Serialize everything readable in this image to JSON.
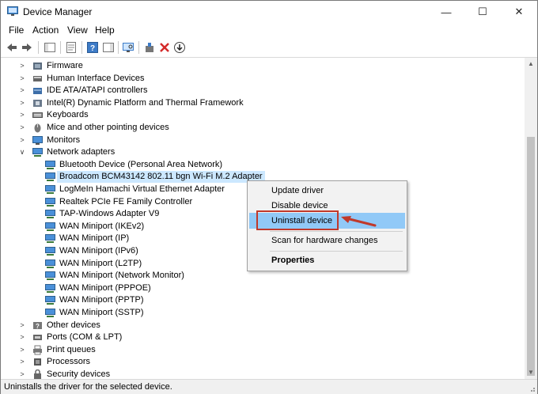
{
  "window": {
    "title": "Device Manager",
    "controls": [
      "—",
      "☐",
      "✕"
    ]
  },
  "menu": [
    "File",
    "Action",
    "View",
    "Help"
  ],
  "tree": {
    "items": [
      {
        "label": "Firmware",
        "level": 0,
        "expanded": false,
        "icon": "firmware-icon"
      },
      {
        "label": "Human Interface Devices",
        "level": 0,
        "expanded": false,
        "icon": "hid-icon"
      },
      {
        "label": "IDE ATA/ATAPI controllers",
        "level": 0,
        "expanded": false,
        "icon": "ide-icon"
      },
      {
        "label": "Intel(R) Dynamic Platform and Thermal Framework",
        "level": 0,
        "expanded": false,
        "icon": "thermal-icon"
      },
      {
        "label": "Keyboards",
        "level": 0,
        "expanded": false,
        "icon": "keyboard-icon"
      },
      {
        "label": "Mice and other pointing devices",
        "level": 0,
        "expanded": false,
        "icon": "mouse-icon"
      },
      {
        "label": "Monitors",
        "level": 0,
        "expanded": false,
        "icon": "monitor-icon"
      },
      {
        "label": "Network adapters",
        "level": 0,
        "expanded": true,
        "icon": "network-icon"
      },
      {
        "label": "Bluetooth Device (Personal Area Network)",
        "level": 1,
        "icon": "network-adapter-icon"
      },
      {
        "label": "Broadcom BCM43142 802.11 bgn Wi-Fi M.2 Adapter",
        "level": 1,
        "selected": true,
        "icon": "network-adapter-icon"
      },
      {
        "label": "LogMeIn Hamachi Virtual Ethernet Adapter",
        "level": 1,
        "icon": "network-adapter-icon"
      },
      {
        "label": "Realtek PCIe FE Family Controller",
        "level": 1,
        "icon": "network-adapter-icon"
      },
      {
        "label": "TAP-Windows Adapter V9",
        "level": 1,
        "icon": "network-adapter-icon"
      },
      {
        "label": "WAN Miniport (IKEv2)",
        "level": 1,
        "icon": "network-adapter-icon"
      },
      {
        "label": "WAN Miniport (IP)",
        "level": 1,
        "icon": "network-adapter-icon"
      },
      {
        "label": "WAN Miniport (IPv6)",
        "level": 1,
        "icon": "network-adapter-icon"
      },
      {
        "label": "WAN Miniport (L2TP)",
        "level": 1,
        "icon": "network-adapter-icon"
      },
      {
        "label": "WAN Miniport (Network Monitor)",
        "level": 1,
        "icon": "network-adapter-icon"
      },
      {
        "label": "WAN Miniport (PPPOE)",
        "level": 1,
        "icon": "network-adapter-icon"
      },
      {
        "label": "WAN Miniport (PPTP)",
        "level": 1,
        "icon": "network-adapter-icon"
      },
      {
        "label": "WAN Miniport (SSTP)",
        "level": 1,
        "icon": "network-adapter-icon"
      },
      {
        "label": "Other devices",
        "level": 0,
        "expanded": false,
        "icon": "other-devices-icon"
      },
      {
        "label": "Ports (COM & LPT)",
        "level": 0,
        "expanded": false,
        "icon": "ports-icon"
      },
      {
        "label": "Print queues",
        "level": 0,
        "expanded": false,
        "icon": "printer-icon"
      },
      {
        "label": "Processors",
        "level": 0,
        "expanded": false,
        "icon": "processor-icon"
      },
      {
        "label": "Security devices",
        "level": 0,
        "expanded": false,
        "icon": "security-icon"
      }
    ]
  },
  "context_menu": {
    "items": [
      "Update driver",
      "Disable device",
      "Uninstall device",
      "Scan for hardware changes",
      "Properties"
    ],
    "highlighted": "Uninstall device"
  },
  "status_bar": {
    "text": "Uninstalls the driver for the selected device."
  },
  "colors": {
    "selection": "#cce8ff",
    "menu_highlight": "#91c9f7",
    "callout": "#c0392b"
  }
}
